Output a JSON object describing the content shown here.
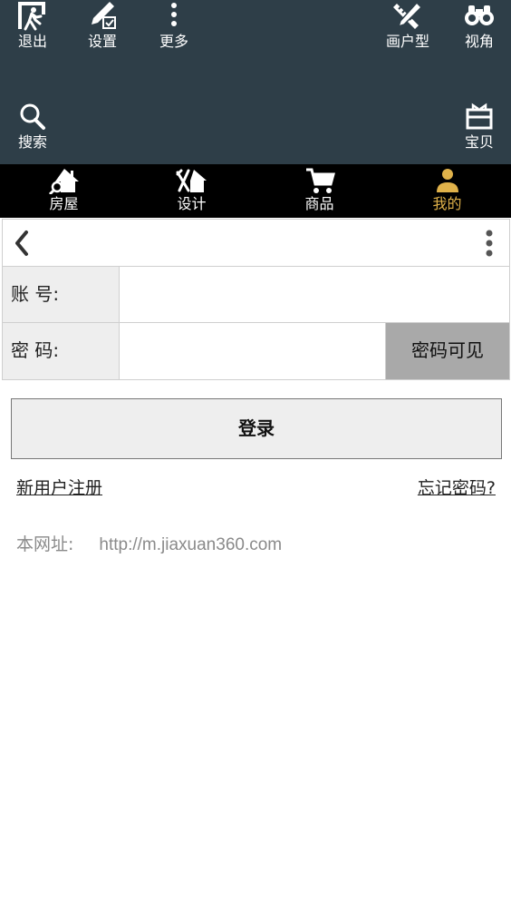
{
  "toolbar": {
    "exit": {
      "label": "退出",
      "icon": "exit-icon"
    },
    "settings": {
      "label": "设置",
      "icon": "edit-settings-icon"
    },
    "more": {
      "label": "更多",
      "icon": "more-vertical-icon"
    },
    "draw": {
      "label": "画户型",
      "icon": "ruler-pencil-icon"
    },
    "view": {
      "label": "视角",
      "icon": "binoculars-icon"
    },
    "search": {
      "label": "搜索",
      "icon": "search-icon"
    },
    "treasure": {
      "label": "宝贝",
      "icon": "gift-box-icon"
    }
  },
  "nav": {
    "tabs": [
      {
        "label": "房屋",
        "icon": "house-search-icon",
        "active": false
      },
      {
        "label": "设计",
        "icon": "tools-house-icon",
        "active": false
      },
      {
        "label": "商品",
        "icon": "cart-icon",
        "active": false
      },
      {
        "label": "我的",
        "icon": "user-icon",
        "active": true
      }
    ]
  },
  "form": {
    "account_label": "账 号:",
    "account_value": "",
    "password_label": "密 码:",
    "password_value": "",
    "password_toggle": "密码可见"
  },
  "login_button": "登录",
  "links": {
    "register": "新用户注册",
    "forgot": "忘记密码?"
  },
  "site": {
    "label": "本网址:",
    "url": "http://m.jiaxuan360.com"
  },
  "colors": {
    "toolbar_bg": "#2e3e48",
    "nav_bg": "#000000",
    "active_tab": "#e0b24a",
    "toggle_bg": "#a9a9a9"
  }
}
